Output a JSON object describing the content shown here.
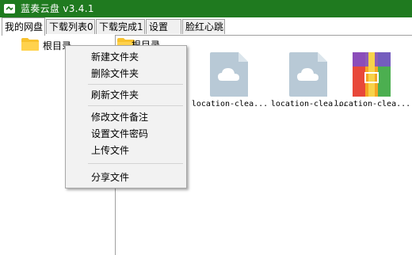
{
  "window": {
    "title": "蓝奏云盘 v3.4.1",
    "accent": "#1f7a1f"
  },
  "tabs": [
    {
      "label": "我的网盘",
      "active": true
    },
    {
      "label": "下载列表0",
      "active": false
    },
    {
      "label": "下载完成1",
      "active": false
    },
    {
      "label": "设置",
      "active": false
    },
    {
      "label": "脸红心跳",
      "active": false
    }
  ],
  "tree": {
    "root_label": "根目录",
    "icon": "folder-icon"
  },
  "files": [
    {
      "icon": "cloud-file-icon",
      "name": "location-clea..."
    },
    {
      "icon": "cloud-file-icon",
      "name": "location-clea..."
    },
    {
      "icon": "archive-file-icon",
      "name": "location-clea..."
    }
  ],
  "context_menu": {
    "items": [
      "新建文件夹",
      "删除文件夹",
      "刷新文件夹",
      "修改文件备注",
      "设置文件密码",
      "上传文件",
      "分享文件"
    ]
  }
}
